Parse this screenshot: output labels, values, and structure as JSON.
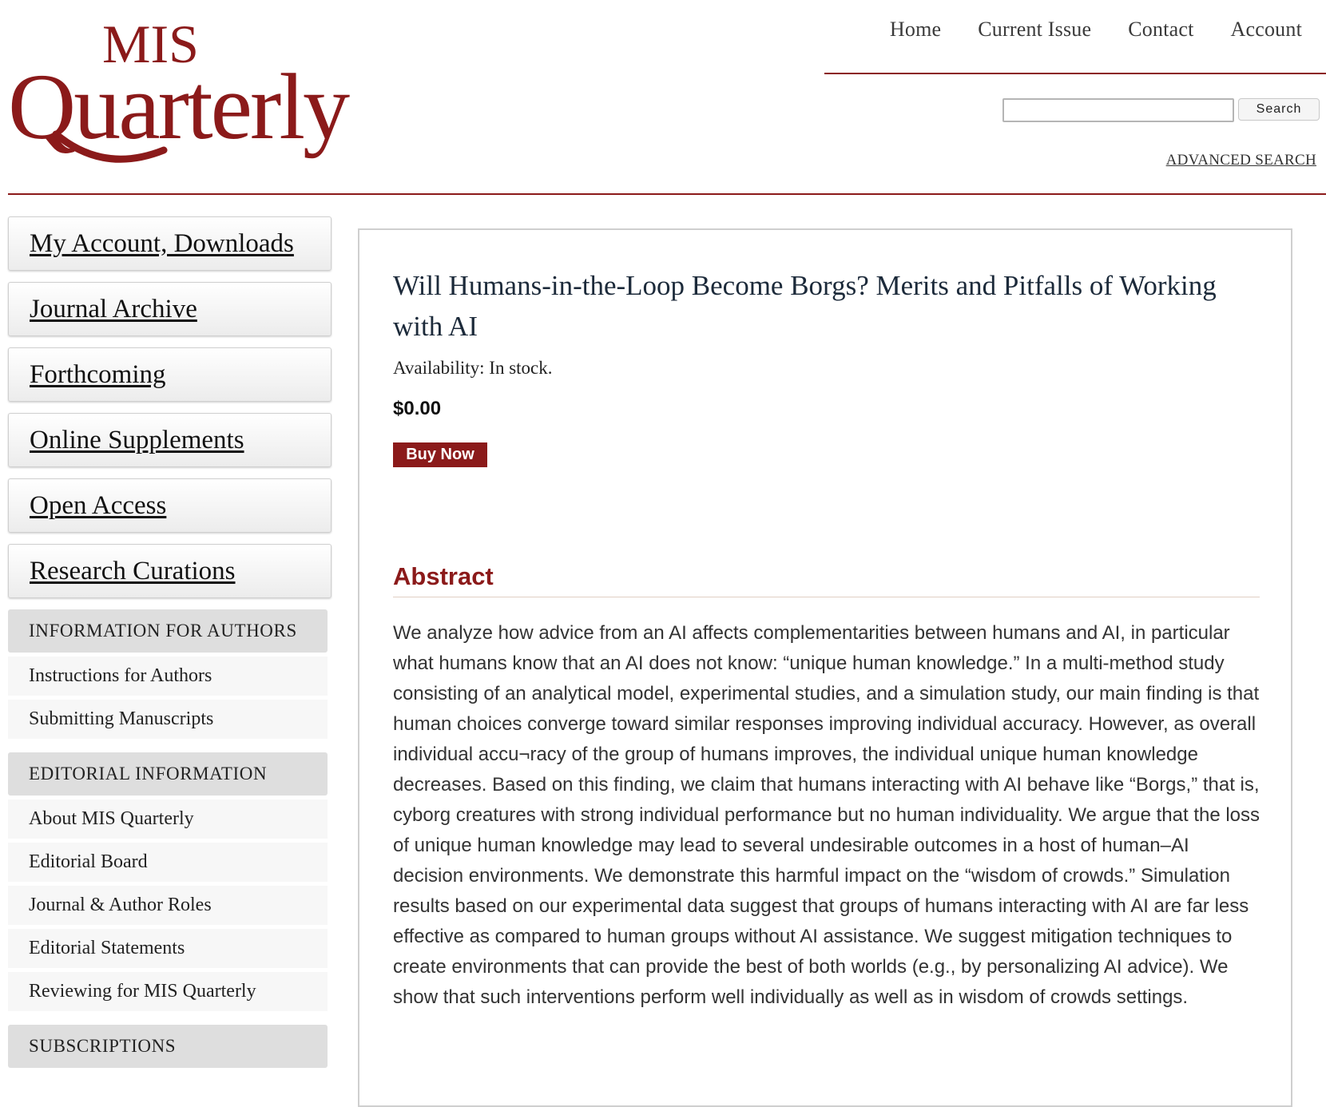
{
  "header": {
    "logo_top": "MIS",
    "logo_main": "Quarterly",
    "nav": [
      "Home",
      "Current Issue",
      "Contact",
      "Account"
    ],
    "search_button": "Search",
    "search_value": "",
    "advanced_search": "ADVANCED SEARCH"
  },
  "sidebar": {
    "buttons": [
      "My Account, Downloads",
      "Journal Archive",
      "Forthcoming",
      "Online Supplements",
      "Open Access",
      "Research Curations"
    ],
    "sections": [
      {
        "title": "INFORMATION FOR AUTHORS",
        "links": [
          "Instructions for Authors",
          "Submitting Manuscripts"
        ]
      },
      {
        "title": "EDITORIAL INFORMATION",
        "links": [
          "About MIS Quarterly",
          "Editorial Board",
          "Journal & Author Roles",
          "Editorial Statements",
          "Reviewing for MIS Quarterly"
        ]
      },
      {
        "title": "SUBSCRIPTIONS",
        "links": []
      }
    ]
  },
  "product": {
    "title": "Will Humans-in-the-Loop Become Borgs? Merits and Pitfalls of Working with AI",
    "availability": "Availability: In stock.",
    "price": "$0.00",
    "buy_button": "Buy Now"
  },
  "abstract": {
    "heading": "Abstract",
    "text": "We analyze how advice from an AI affects complementarities between humans and AI, in particular what humans know that an AI does not know: “unique human knowledge.” In a multi-method study consisting of an analytical model, experimental studies, and a simulation study, our main finding is that human choices converge toward similar responses improving individual accuracy. However, as overall individual accu¬racy of the group of humans improves, the individual unique human knowledge decreases. Based on this finding, we claim that humans interacting with AI behave like “Borgs,” that is, cyborg creatures with strong individual performance but no human individuality. We argue that the loss of unique human knowledge may lead to several undesirable outcomes in a host of human–AI decision environments. We demonstrate this harmful impact on the “wisdom of crowds.” Simulation results based on our experimental data suggest that groups of humans interacting with AI are far less effective as compared to human groups without AI assistance. We suggest mitigation techniques to create environments that can provide the best of both worlds (e.g., by personalizing AI advice). We show that such interventions perform well individually as well as in wisdom of crowds settings."
  },
  "colors": {
    "brand": "#8b1a1a",
    "title": "#1c2a3a",
    "sidebar_header_bg": "#dedede"
  }
}
